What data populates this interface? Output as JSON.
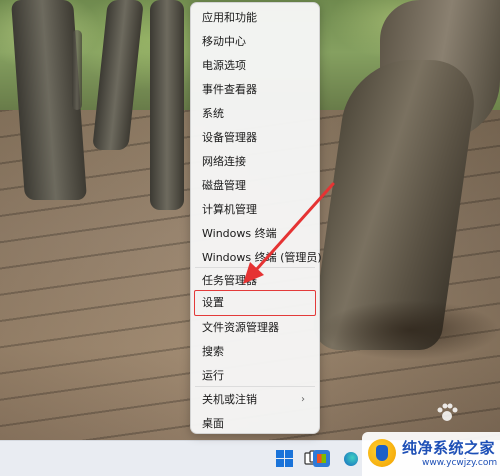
{
  "menu": {
    "items": [
      {
        "label": "应用和功能"
      },
      {
        "label": "移动中心"
      },
      {
        "label": "电源选项"
      },
      {
        "label": "事件查看器"
      },
      {
        "label": "系统"
      },
      {
        "label": "设备管理器"
      },
      {
        "label": "网络连接"
      },
      {
        "label": "磁盘管理"
      },
      {
        "label": "计算机管理"
      },
      {
        "label": "Windows 终端"
      },
      {
        "label": "Windows 终端 (管理员)"
      },
      {
        "label": "任务管理器"
      },
      {
        "label": "设置"
      },
      {
        "label": "文件资源管理器"
      },
      {
        "label": "搜索"
      },
      {
        "label": "运行"
      },
      {
        "label": "关机或注销"
      },
      {
        "label": "桌面"
      }
    ],
    "highlighted_item": "设置",
    "submenu_chevron": "›"
  },
  "annotation": {
    "arrow_color": "#e53333",
    "box_color": "#e33a3a"
  },
  "taskbar": {
    "icons": [
      "windows-start-icon",
      "task-view-icon",
      "store-icon",
      "edge-icon"
    ]
  },
  "watermark": {
    "title": "纯净系统之家",
    "url": "www.ycwjzy.com"
  }
}
